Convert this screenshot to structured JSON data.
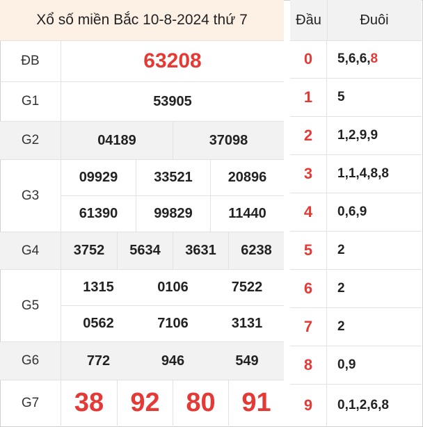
{
  "title": "Xổ số miền Bắc 10-8-2024 thứ 7",
  "prizes": {
    "db": {
      "label": "ĐB",
      "numbers": [
        "63208"
      ]
    },
    "g1": {
      "label": "G1",
      "numbers": [
        "53905"
      ]
    },
    "g2": {
      "label": "G2",
      "numbers": [
        "04189",
        "37098"
      ]
    },
    "g3": {
      "label": "G3",
      "numbers": [
        "09929",
        "33521",
        "20896",
        "61390",
        "99829",
        "11440"
      ]
    },
    "g4": {
      "label": "G4",
      "numbers": [
        "3752",
        "5634",
        "3631",
        "6238"
      ]
    },
    "g5": {
      "label": "G5",
      "numbers": [
        "1315",
        "0106",
        "7522",
        "0562",
        "7106",
        "3131"
      ]
    },
    "g6": {
      "label": "G6",
      "numbers": [
        "772",
        "946",
        "549"
      ]
    },
    "g7": {
      "label": "G7",
      "numbers": [
        "38",
        "92",
        "80",
        "91"
      ]
    }
  },
  "loto": {
    "header_dau": "Đầu",
    "header_duoi": "Đuôi",
    "rows": [
      {
        "dau": "0",
        "duoi_plain": "5,6,6,",
        "duoi_red": "8"
      },
      {
        "dau": "1",
        "duoi_plain": "5",
        "duoi_red": ""
      },
      {
        "dau": "2",
        "duoi_plain": "1,2,9,9",
        "duoi_red": ""
      },
      {
        "dau": "3",
        "duoi_plain": "1,1,4,8,8",
        "duoi_red": ""
      },
      {
        "dau": "4",
        "duoi_plain": "0,6,9",
        "duoi_red": ""
      },
      {
        "dau": "5",
        "duoi_plain": "2",
        "duoi_red": ""
      },
      {
        "dau": "6",
        "duoi_plain": "2",
        "duoi_red": ""
      },
      {
        "dau": "7",
        "duoi_plain": "2",
        "duoi_red": ""
      },
      {
        "dau": "8",
        "duoi_plain": "0,9",
        "duoi_red": ""
      },
      {
        "dau": "9",
        "duoi_plain": "0,1,2,6,8",
        "duoi_red": ""
      }
    ]
  },
  "colors": {
    "accent_red": "#e53935",
    "header_bg": "#fdf1e6",
    "stripe_bg": "#f2f2f2"
  }
}
